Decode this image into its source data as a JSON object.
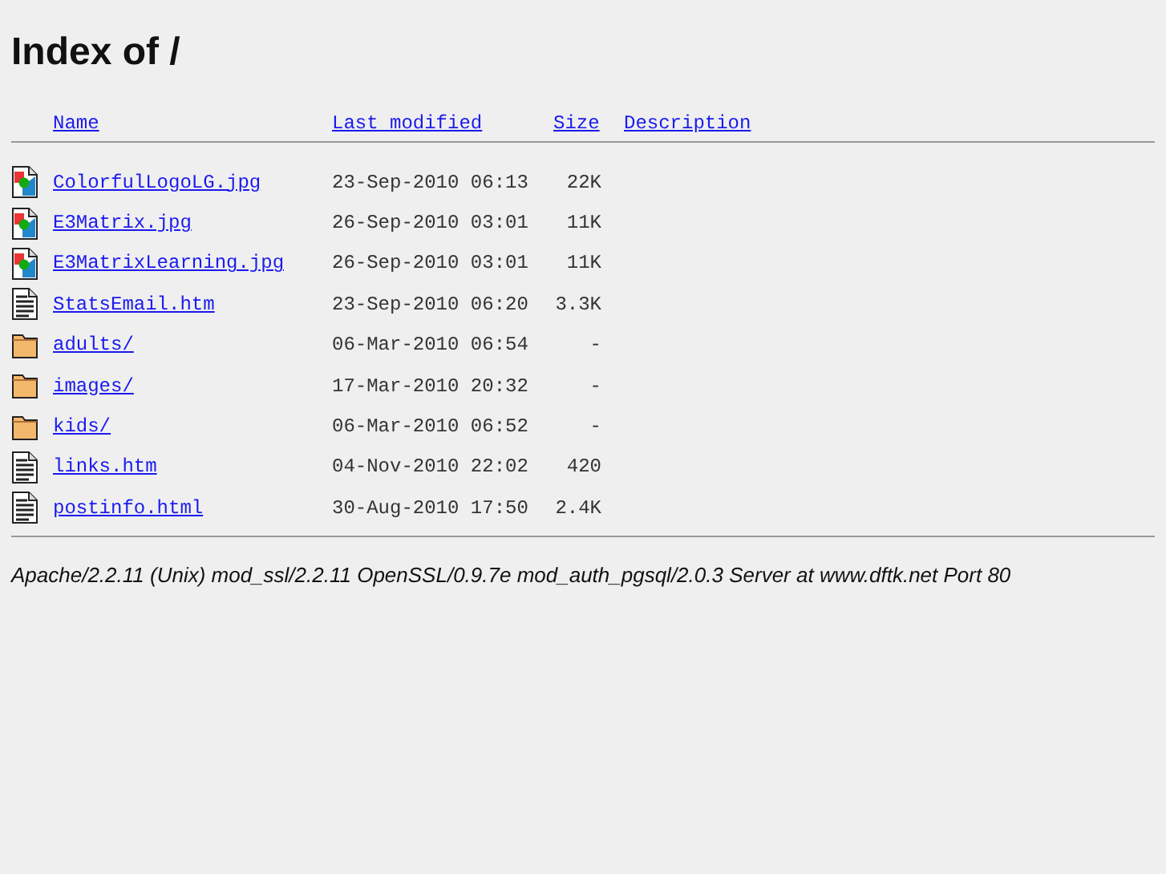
{
  "title": "Index of /",
  "columns": [
    "Name",
    "Last modified",
    "Size",
    "Description"
  ],
  "rows": [
    {
      "kind": "image",
      "name": "ColorfulLogoLG.jpg",
      "modified": "23-Sep-2010 06:13",
      "size": "22K"
    },
    {
      "kind": "image",
      "name": "E3Matrix.jpg",
      "modified": "26-Sep-2010 03:01",
      "size": "11K"
    },
    {
      "kind": "image",
      "name": "E3MatrixLearning.jpg",
      "modified": "26-Sep-2010 03:01",
      "size": "11K"
    },
    {
      "kind": "text",
      "name": "StatsEmail.htm",
      "modified": "23-Sep-2010 06:20",
      "size": "3.3K"
    },
    {
      "kind": "folder",
      "name": "adults/",
      "modified": "06-Mar-2010 06:54",
      "size": "-"
    },
    {
      "kind": "folder",
      "name": "images/",
      "modified": "17-Mar-2010 20:32",
      "size": "-"
    },
    {
      "kind": "folder",
      "name": "kids/",
      "modified": "06-Mar-2010 06:52",
      "size": "-"
    },
    {
      "kind": "text",
      "name": "links.htm",
      "modified": "04-Nov-2010 22:02",
      "size": "420"
    },
    {
      "kind": "text",
      "name": "postinfo.html",
      "modified": "30-Aug-2010 17:50",
      "size": "2.4K"
    }
  ],
  "address": "Apache/2.2.11 (Unix) mod_ssl/2.2.11 OpenSSL/0.9.7e mod_auth_pgsql/2.0.3 Server at www.dftk.net Port 80"
}
